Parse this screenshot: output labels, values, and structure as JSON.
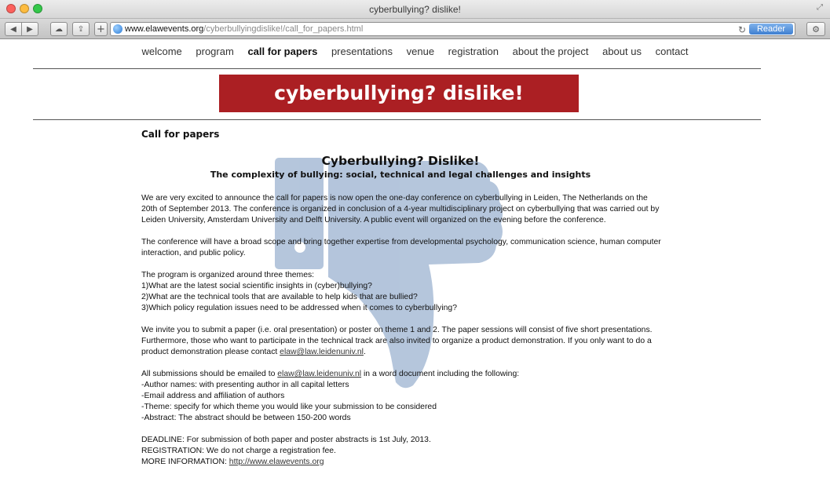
{
  "window": {
    "title": "cyberbullying? dislike!"
  },
  "toolbar": {
    "url_host": "www.elawevents.org",
    "url_path": "/cyberbullyingdislike!/call_for_papers.html",
    "reader_label": "Reader"
  },
  "nav": {
    "items": [
      {
        "label": "welcome"
      },
      {
        "label": "program"
      },
      {
        "label": "call for papers",
        "active": true
      },
      {
        "label": "presentations"
      },
      {
        "label": "venue"
      },
      {
        "label": "registration"
      },
      {
        "label": "about the project"
      },
      {
        "label": "about us"
      },
      {
        "label": "contact"
      }
    ]
  },
  "banner": {
    "text": "cyberbullying? dislike!",
    "color": "#ab1f23"
  },
  "watermark": {
    "icon": "thumbs-down-icon",
    "color": "#a8bcd6"
  },
  "page": {
    "section_title": "Call for papers",
    "doc_title": "Cyberbullying? Dislike!",
    "doc_subtitle": "The complexity of bullying: social, technical and legal challenges and insights",
    "intro": {
      "l1": "We are very excited to announce the call for papers is now open the one-day conference on cyberbullying in Leiden, The Netherlands on the",
      "l2": "20th of September 2013. The conference is organized in conclusion of a 4-year multidisciplinary project on cyberbullying that was carried out by",
      "l3": "Leiden University, Amsterdam University and Delft University.  A public event will organized on the evening before the conference."
    },
    "scope": {
      "l1": "The conference will have a broad scope and bring together expertise from developmental psychology, communication science, human computer",
      "l2": "interaction, and public policy."
    },
    "themes": {
      "intro": "The program is organized around three themes:",
      "t1": "1)What are the latest social scientific insights in (cyber)bullying?",
      "t2": "2)What are the technical tools that are available to help kids that are bullied?",
      "t3": "3)Which policy regulation issues need to be addressed when it comes to cyberbullying?"
    },
    "invite": {
      "l1": "We invite you to submit a paper (i.e. oral presentation) or poster on theme 1 and 2. The paper sessions will consist of five short presentations.",
      "l2": "Furthermore, those who want to participate in the technical track are also invited to organize a product demonstration. If you only want to do a",
      "l3_pre": "product demonstration please contact ",
      "email": "elaw@law.leidenuniv.nl",
      "l3_post": "."
    },
    "submission": {
      "pre": "All submissions should be emailed to ",
      "email": "elaw@law.leidenuniv.nl",
      "post": " in a word document including the following:",
      "items": [
        "-Author names: with presenting author in all capital letters",
        "-Email address and affiliation of authors",
        "-Theme: specify for which theme you would like your submission to be considered",
        "-Abstract: The abstract should be between 150-200 words"
      ]
    },
    "info": {
      "deadline": "DEADLINE: For submission of both paper and poster abstracts is 1st July, 2013.",
      "registration": "REGISTRATION: We do not charge a registration fee.",
      "more_pre": "MORE INFORMATION: ",
      "more_link": "http://www.elawevents.org"
    }
  }
}
